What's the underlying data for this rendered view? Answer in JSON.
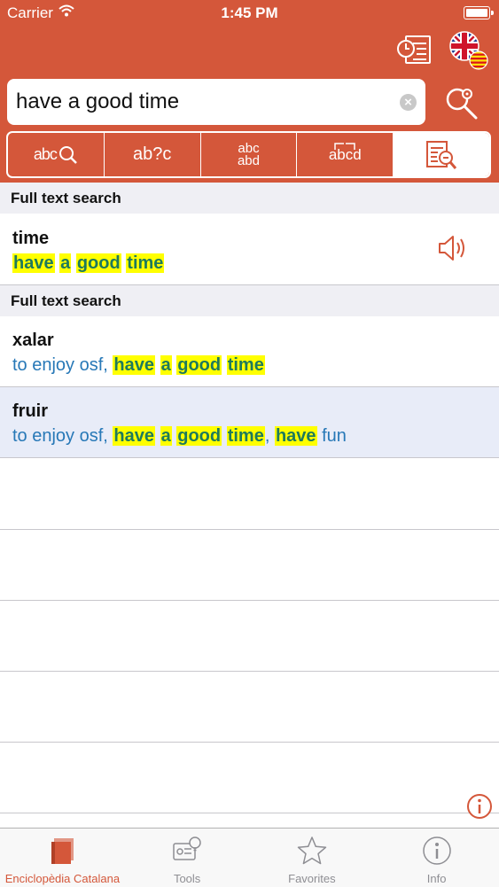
{
  "status_bar": {
    "carrier": "Carrier",
    "time": "1:45 PM"
  },
  "search": {
    "value": "have a good time"
  },
  "modes": [
    {
      "label": "abc"
    },
    {
      "label": "ab?c"
    },
    {
      "label": "abc abd"
    },
    {
      "label": "abcd"
    }
  ],
  "sections": [
    {
      "header": "Full text search",
      "entries": [
        {
          "headword": "time",
          "translation": [
            {
              "t": "have",
              "hl": true
            },
            {
              "t": " ",
              "hl": false
            },
            {
              "t": "a",
              "hl": true
            },
            {
              "t": " ",
              "hl": false
            },
            {
              "t": "good",
              "hl": true
            },
            {
              "t": " ",
              "hl": false
            },
            {
              "t": "time",
              "hl": true
            }
          ],
          "audio": true
        }
      ]
    },
    {
      "header": "Full text search",
      "entries": [
        {
          "headword": "xalar",
          "translation": [
            {
              "t": "to enjoy osf, ",
              "hl": false
            },
            {
              "t": "have",
              "hl": true
            },
            {
              "t": " ",
              "hl": false
            },
            {
              "t": "a",
              "hl": true
            },
            {
              "t": " ",
              "hl": false
            },
            {
              "t": "good",
              "hl": true
            },
            {
              "t": " ",
              "hl": false
            },
            {
              "t": "time",
              "hl": true
            }
          ],
          "audio": false
        },
        {
          "headword": "fruir",
          "translation": [
            {
              "t": "to enjoy osf, ",
              "hl": false
            },
            {
              "t": "have",
              "hl": true
            },
            {
              "t": " ",
              "hl": false
            },
            {
              "t": "a",
              "hl": true
            },
            {
              "t": " ",
              "hl": false
            },
            {
              "t": "good",
              "hl": true
            },
            {
              "t": " ",
              "hl": false
            },
            {
              "t": "time",
              "hl": true
            },
            {
              "t": ", ",
              "hl": false
            },
            {
              "t": "have",
              "hl": true
            },
            {
              "t": " fun",
              "hl": false
            }
          ],
          "audio": false,
          "selected": true
        }
      ]
    }
  ],
  "tabs": [
    {
      "label": "Enciclopèdia Catalana",
      "icon": "dictionary-book-icon",
      "active": true
    },
    {
      "label": "Tools",
      "icon": "tools-icon",
      "active": false
    },
    {
      "label": "Favorites",
      "icon": "star-icon",
      "active": false
    },
    {
      "label": "Info",
      "icon": "info-icon",
      "active": false
    }
  ],
  "colors": {
    "accent": "#D4573A",
    "highlight": "#FFFF00",
    "highlight_text": "#1E7A5C",
    "translation_text": "#2778B7",
    "section_bg": "#EFEFF4",
    "selected_row": "#E8ECF8"
  }
}
